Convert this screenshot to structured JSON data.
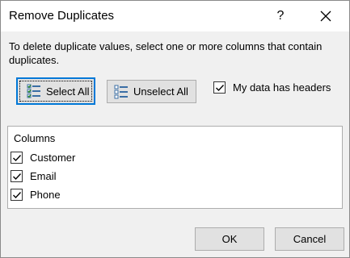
{
  "window": {
    "title": "Remove Duplicates",
    "help": "?"
  },
  "description": "To delete duplicate values, select one or more columns that contain duplicates.",
  "toolbar": {
    "select_all": "Select All",
    "unselect_all": "Unselect All",
    "headers_checkbox": {
      "label": "My data has headers",
      "checked": true
    }
  },
  "columns": {
    "header": "Columns",
    "items": [
      {
        "label": "Customer",
        "checked": true
      },
      {
        "label": "Email",
        "checked": true
      },
      {
        "label": "Phone",
        "checked": true
      }
    ]
  },
  "footer": {
    "ok": "OK",
    "cancel": "Cancel"
  },
  "colors": {
    "focus_border": "#0078d7",
    "dialog_bg": "#f0f0f0",
    "button_bg": "#e1e1e1"
  }
}
